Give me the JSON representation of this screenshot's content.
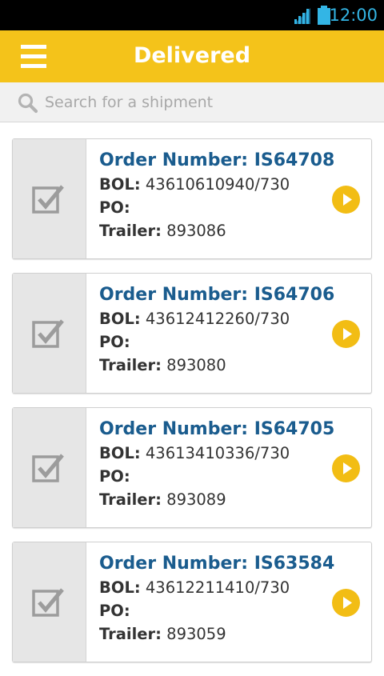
{
  "status_bar": {
    "time": "12:00"
  },
  "app_bar": {
    "title": "Delivered"
  },
  "search": {
    "placeholder": "Search for a shipment"
  },
  "labels": {
    "order": "Order Number:",
    "bol": "BOL:",
    "po": "PO:",
    "trailer": "Trailer:"
  },
  "shipments": [
    {
      "order_number": "IS64708",
      "bol": "43610610940/730",
      "po": "",
      "trailer": "893086"
    },
    {
      "order_number": "IS64706",
      "bol": "43612412260/730",
      "po": "",
      "trailer": "893080"
    },
    {
      "order_number": "IS64705",
      "bol": "43613410336/730",
      "po": "",
      "trailer": "893089"
    },
    {
      "order_number": "IS63584",
      "bol": "43612211410/730",
      "po": "",
      "trailer": "893059"
    }
  ],
  "colors": {
    "app_bar": "#f4c31a",
    "accent": "#f2bd14",
    "order_text": "#1a5c8e",
    "status_icons": "#33b5e5"
  },
  "icons": {
    "menu": "hamburger-icon",
    "search": "search-icon",
    "row_status": "checkbox-checked-icon",
    "row_action": "play-icon"
  }
}
